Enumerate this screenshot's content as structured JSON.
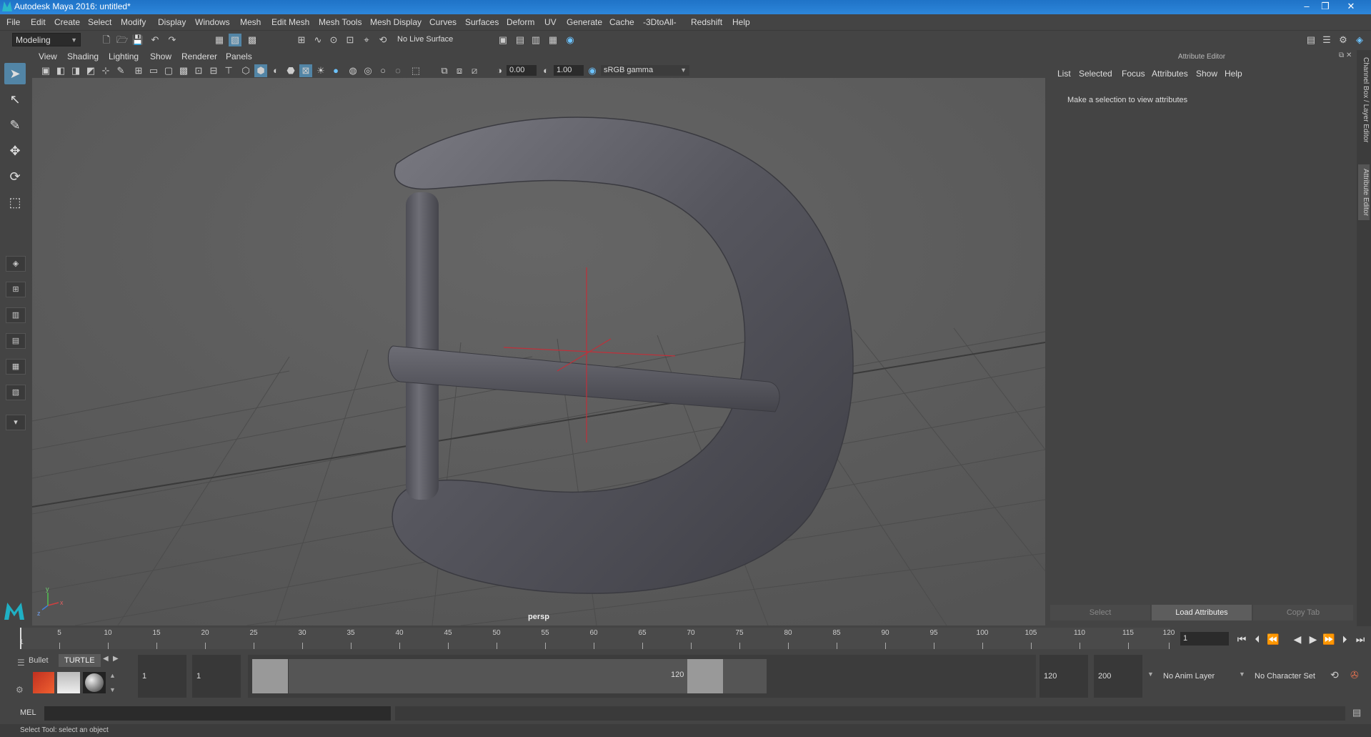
{
  "window": {
    "title": "Autodesk Maya 2016: untitled*",
    "controls": [
      "–",
      "❐",
      "✕"
    ]
  },
  "menus": [
    "File",
    "Edit",
    "Create",
    "Select",
    "Modify",
    "Display",
    "Windows",
    "Mesh",
    "Edit Mesh",
    "Mesh Tools",
    "Mesh Display",
    "Curves",
    "Surfaces",
    "Deform",
    "UV",
    "Generate",
    "Cache",
    "-3DtoAll-",
    "Redshift",
    "Help"
  ],
  "status": {
    "mode": "Modeling",
    "live_surface": "No Live Surface"
  },
  "panel_menus": [
    "View",
    "Shading",
    "Lighting",
    "Show",
    "Renderer",
    "Panels"
  ],
  "panel_toolbar": {
    "near_value": "0.00",
    "far_value": "1.00",
    "color_space": "sRGB gamma"
  },
  "viewport": {
    "camera_label": "persp",
    "axis": {
      "x": "x",
      "y": "y",
      "z": "z"
    }
  },
  "attribute_editor": {
    "header": "Attribute Editor",
    "tabs": [
      "List",
      "Selected",
      "Focus",
      "Attributes",
      "Show",
      "Help"
    ],
    "message": "Make a selection to view attributes",
    "buttons": {
      "select": "Select",
      "load": "Load Attributes",
      "copy": "Copy Tab"
    }
  },
  "side_tabs": {
    "channel_box": "Channel Box / Layer Editor",
    "attribute_editor": "Attribute Editor"
  },
  "time_slider": {
    "labels": [
      "1",
      "5",
      "10",
      "15",
      "20",
      "25",
      "30",
      "35",
      "40",
      "45",
      "50",
      "55",
      "60",
      "65",
      "70",
      "75",
      "80",
      "85",
      "90",
      "95",
      "100",
      "105",
      "110",
      "115",
      "120"
    ],
    "current_frame": "1"
  },
  "range": {
    "shelf_tabs": [
      "Bullet",
      "TURTLE"
    ],
    "start": "1",
    "anim_start": "1",
    "slider_start": "1",
    "slider_end": "120",
    "end": "120",
    "anim_end": "200",
    "anim_layer": "No Anim Layer",
    "character_set": "No Character Set"
  },
  "command": {
    "lang": "MEL"
  },
  "help_line": "Select Tool: select an object"
}
